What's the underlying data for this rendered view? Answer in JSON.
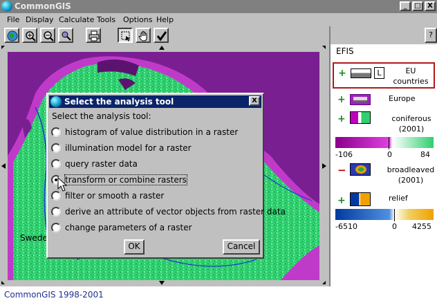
{
  "window": {
    "title": "CommonGIS",
    "min": "_",
    "max": "□",
    "close": "X"
  },
  "menu": [
    "File",
    "Display",
    "Calculate",
    "Tools",
    "Options",
    "Help"
  ],
  "toolbar": {
    "icons": [
      "globe-icon",
      "zoom-in-icon",
      "zoom-out-icon",
      "find-icon",
      "print-icon",
      "select-icon",
      "hand-icon",
      "check-icon"
    ],
    "help_label": "?"
  },
  "legend": {
    "group_title": "EFIS",
    "layers": [
      {
        "name": "EU countries",
        "badge": "L",
        "highlighted": true
      },
      {
        "name": "Europe"
      },
      {
        "name": "coniferous (2001)",
        "scale": {
          "min": "-106",
          "mid": "0",
          "max": "84"
        }
      },
      {
        "name": "broadleaved (2001)",
        "collapsed": true
      },
      {
        "name": "relief",
        "scale": {
          "min": "-6510",
          "mid": "0",
          "max": "4255"
        }
      }
    ]
  },
  "map": {
    "place_label": "Swede"
  },
  "dialog": {
    "title": "Select the analysis tool",
    "close": "X",
    "prompt": "Select the analysis tool:",
    "options": [
      "histogram of value distribution in a raster",
      "illumination model for a raster",
      "query raster data",
      "transform or combine rasters",
      "filter or smooth a raster",
      "derive an attribute of vector objects from raster data",
      "change parameters of a raster"
    ],
    "selected_index": 3,
    "ok_label": "OK",
    "cancel_label": "Cancel"
  },
  "status": {
    "text": "CommonGIS 1998-2001"
  },
  "colors": {
    "highlight_border": "#b01818",
    "titlebar": "#0a246a",
    "status_text": "#1f2f8f"
  }
}
